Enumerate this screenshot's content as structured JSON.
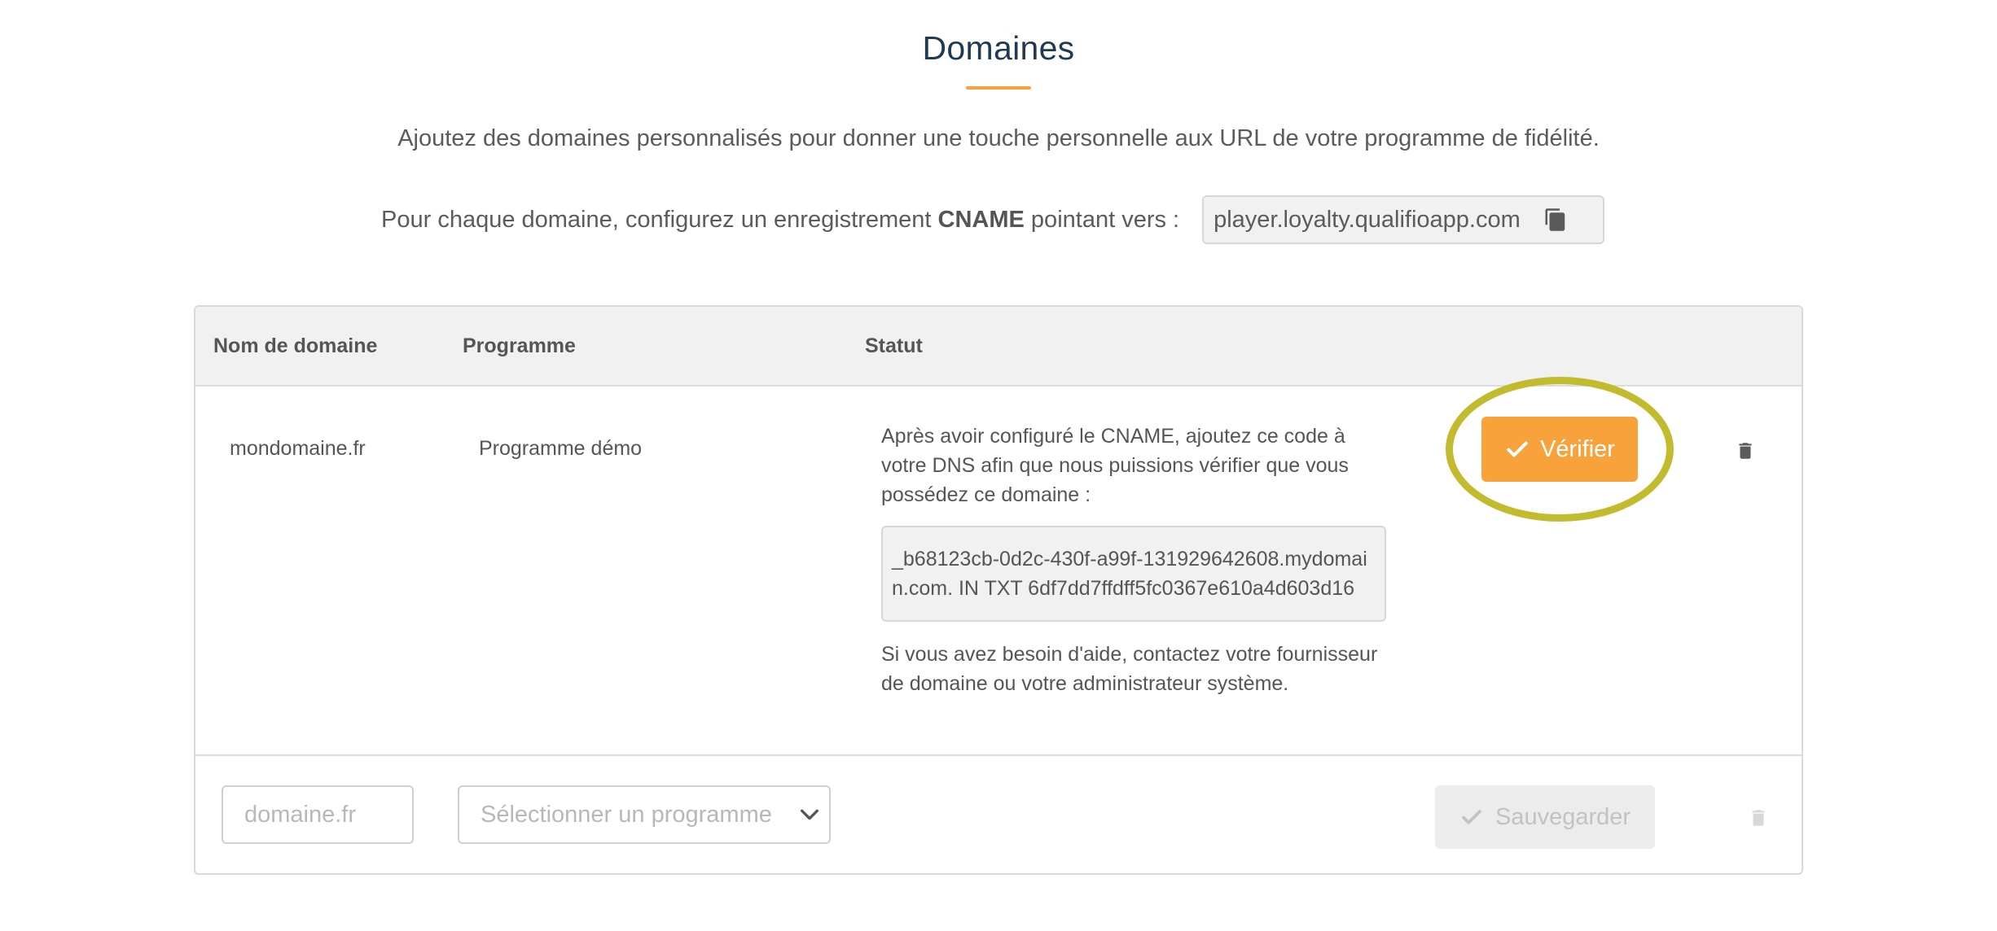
{
  "page": {
    "title": "Domaines",
    "intro": "Ajoutez des domaines personnalisés pour donner une touche personnelle aux URL de votre programme de fidélité.",
    "cname_prefix": "Pour chaque domaine, configurez un enregistrement ",
    "cname_keyword": "CNAME",
    "cname_suffix": " pointant vers :",
    "cname_target": "player.loyalty.qualifioapp.com",
    "copy_icon": "copy-icon"
  },
  "table": {
    "headers": {
      "domain": "Nom de domaine",
      "program": "Programme",
      "status": "Statut"
    },
    "rows": [
      {
        "domain": "mondomaine.fr",
        "program": "Programme démo",
        "status_instructions": "Après avoir configuré le CNAME, ajoutez ce code à votre DNS afin que nous puissions vérifier que vous possédez ce domaine :",
        "txt_record": "_b68123cb-0d2c-430f-a99f-131929642608.mydomain.com. IN TXT 6df7dd7ffdff5fc0367e610a4d603d16",
        "status_help": "Si vous avez besoin d'aide, contactez votre fournisseur de domaine ou votre administrateur système.",
        "verify_label": "Vérifier",
        "delete_icon": "trash-icon"
      }
    ],
    "new_row": {
      "domain_placeholder": "domaine.fr",
      "domain_value": "",
      "program_placeholder": "Sélectionner un programme",
      "save_label": "Sauvegarder",
      "delete_icon": "trash-icon"
    }
  },
  "colors": {
    "accent": "#f7a23b",
    "heading": "#1f3a52",
    "highlight_ring": "#c3bb2e",
    "header_bg": "#f1f1f1",
    "disabled_bg": "#ececec"
  }
}
